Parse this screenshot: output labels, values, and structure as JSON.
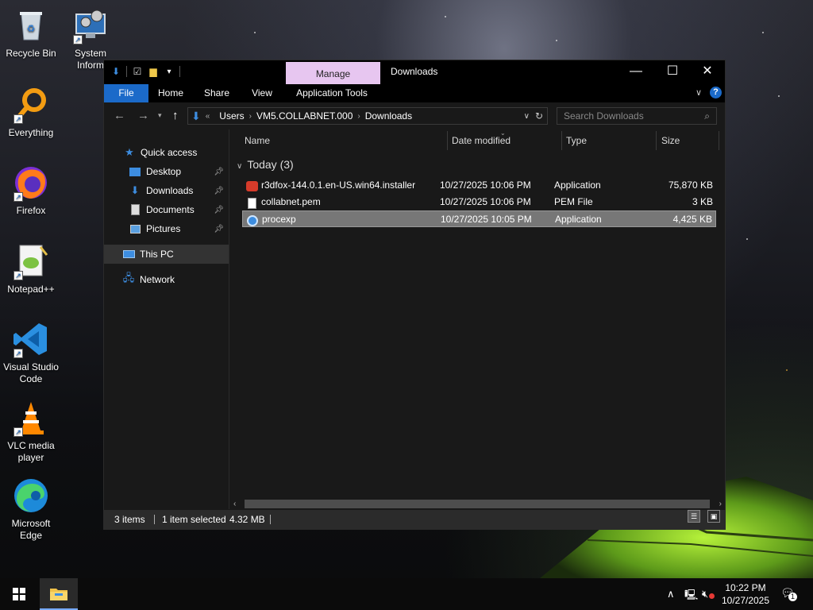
{
  "desktop": {
    "icons": [
      {
        "label": "Recycle Bin"
      },
      {
        "label": "System Inform"
      },
      {
        "label": "Everything"
      },
      {
        "label": "Firefox"
      },
      {
        "label": "Notepad++"
      },
      {
        "label": "Visual Studio Code"
      },
      {
        "label": "VLC media player"
      },
      {
        "label": "Microsoft Edge"
      }
    ]
  },
  "window": {
    "title": "Downloads",
    "contextual_tab": "Manage",
    "ribbon_tabs": [
      "File",
      "Home",
      "Share",
      "View",
      "Application Tools"
    ],
    "address": {
      "prefix": "«",
      "segments": [
        "Users",
        "VM5.COLLABNET.000",
        "Downloads"
      ]
    },
    "search_placeholder": "Search Downloads",
    "nav": {
      "quick_access": "Quick access",
      "items": [
        "Desktop",
        "Downloads",
        "Documents",
        "Pictures"
      ],
      "this_pc": "This PC",
      "network": "Network"
    },
    "columns": [
      "Name",
      "Date modified",
      "Type",
      "Size"
    ],
    "group_label": "Today (3)",
    "files": [
      {
        "name": "r3dfox-144.0.1.en-US.win64.installer",
        "date": "10/27/2025 10:06 PM",
        "type": "Application",
        "size": "75,870 KB"
      },
      {
        "name": "collabnet.pem",
        "date": "10/27/2025 10:06 PM",
        "type": "PEM File",
        "size": "3 KB"
      },
      {
        "name": "procexp",
        "date": "10/27/2025 10:05 PM",
        "type": "Application",
        "size": "4,425 KB"
      }
    ],
    "status": {
      "items": "3 items",
      "selected": "1 item selected",
      "size": "4.32 MB"
    }
  },
  "taskbar": {
    "time": "10:22 PM",
    "date": "10/27/2025",
    "notification_count": "1"
  },
  "colors": {
    "accent": "#1b6ac9",
    "manage_tab": "#e7c6f0",
    "selection": "#777777"
  }
}
